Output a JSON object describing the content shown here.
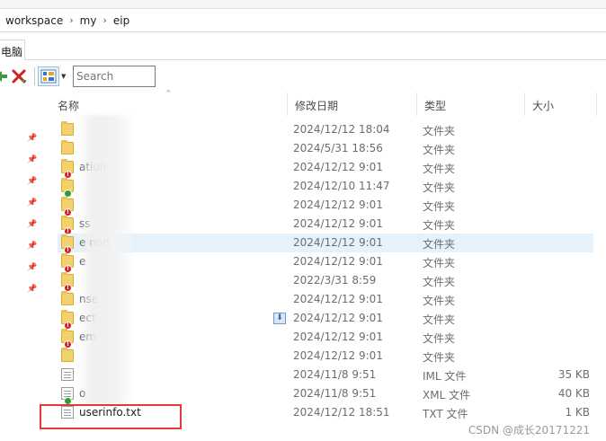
{
  "address": {
    "segments": [
      "workspace",
      "my",
      "eip"
    ],
    "separator": "›"
  },
  "ribbon": {
    "tab_label": "电脑"
  },
  "toolbar": {
    "search_placeholder": "Search"
  },
  "columns": {
    "name": "名称",
    "date": "修改日期",
    "type": "类型",
    "size": "大小"
  },
  "rows": [
    {
      "name": "",
      "date": "2024/12/12 18:04",
      "type": "文件夹",
      "size": "",
      "icon": "folder-icon",
      "overlay": ""
    },
    {
      "name": "",
      "date": "2024/5/31 18:56",
      "type": "文件夹",
      "size": "",
      "icon": "folder-icon",
      "overlay": ""
    },
    {
      "name": "ation",
      "date": "2024/12/12 9:01",
      "type": "文件夹",
      "size": "",
      "icon": "folder-icon",
      "overlay": "red"
    },
    {
      "name": "",
      "date": "2024/12/10 11:47",
      "type": "文件夹",
      "size": "",
      "icon": "folder-icon",
      "overlay": "green"
    },
    {
      "name": "",
      "date": "2024/12/12 9:01",
      "type": "文件夹",
      "size": "",
      "icon": "folder-icon",
      "overlay": "red"
    },
    {
      "name": "ss",
      "date": "2024/12/12 9:01",
      "type": "文件夹",
      "size": "",
      "icon": "folder-icon",
      "overlay": "red"
    },
    {
      "name": "e non",
      "date": "2024/12/12 9:01",
      "type": "文件夹",
      "size": "",
      "icon": "folder-icon",
      "overlay": "red"
    },
    {
      "name": "e",
      "date": "2024/12/12 9:01",
      "type": "文件夹",
      "size": "",
      "icon": "folder-icon",
      "overlay": "red"
    },
    {
      "name": "",
      "date": "2022/3/31 8:59",
      "type": "文件夹",
      "size": "",
      "icon": "folder-icon",
      "overlay": "red"
    },
    {
      "name": "nse",
      "date": "2024/12/12 9:01",
      "type": "文件夹",
      "size": "",
      "icon": "folder-icon",
      "overlay": ""
    },
    {
      "name": "ect",
      "date": "2024/12/12 9:01",
      "type": "文件夹",
      "size": "",
      "icon": "folder-icon",
      "overlay": "red"
    },
    {
      "name": "em",
      "date": "2024/12/12 9:01",
      "type": "文件夹",
      "size": "",
      "icon": "folder-icon",
      "overlay": "red"
    },
    {
      "name": "",
      "date": "2024/12/12 9:01",
      "type": "文件夹",
      "size": "",
      "icon": "folder-icon",
      "overlay": ""
    },
    {
      "name": "",
      "date": "2024/11/8 9:51",
      "type": "IML 文件",
      "size": "35 KB",
      "icon": "file-icon",
      "overlay": ""
    },
    {
      "name": "o",
      "date": "2024/11/8 9:51",
      "type": "XML 文件",
      "size": "40 KB",
      "icon": "file-icon",
      "overlay": "green"
    },
    {
      "name": "userinfo.txt",
      "date": "2024/12/12 18:51",
      "type": "TXT 文件",
      "size": "1 KB",
      "icon": "file-icon",
      "overlay": ""
    }
  ],
  "highlighted_row": 6,
  "watermark": "CSDN @成长20171221",
  "colors": {
    "hover": "#e5f1fb",
    "callout": "#e53935",
    "error_overlay": "#d91c1c",
    "ok_overlay": "#2e9e2e"
  }
}
